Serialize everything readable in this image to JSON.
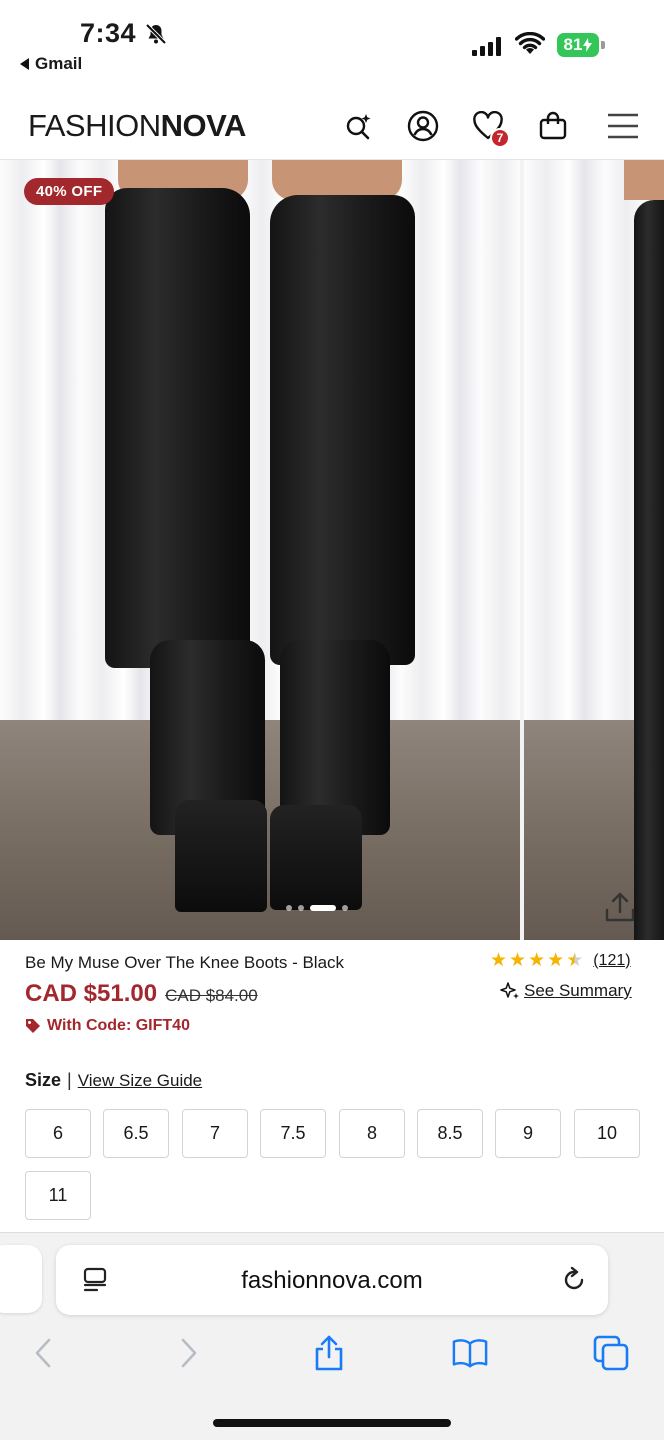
{
  "status_bar": {
    "time": "7:34",
    "back_app": "Gmail",
    "battery": "81",
    "icons": [
      "bell-slash-icon",
      "cellular-signal-icon",
      "wifi-icon",
      "battery-charging-icon"
    ]
  },
  "header": {
    "logo_light": "FASHION",
    "logo_bold": "NOVA",
    "wishlist_count": "7",
    "icons": [
      "ai-search-icon",
      "account-icon",
      "heart-icon",
      "bag-icon",
      "menu-icon"
    ]
  },
  "gallery": {
    "sale_badge": "40% OFF",
    "slide_count": 4,
    "active_slide": 3
  },
  "product": {
    "name": "Be My Muse Over The Knee Boots - Black",
    "rating": 4.5,
    "review_count": "(121)",
    "price_now": "CAD $51.00",
    "price_was": "CAD $84.00",
    "see_summary": "See Summary",
    "promo_code": "With Code: GIFT40"
  },
  "sizes": {
    "label": "Size",
    "separator": "|",
    "guide_link": "View Size Guide",
    "options": [
      "6",
      "6.5",
      "7",
      "7.5",
      "8",
      "8.5",
      "9",
      "10",
      "11"
    ]
  },
  "safari": {
    "url": "fashionnova.com",
    "toolbar": [
      "back-icon",
      "forward-icon",
      "share-icon",
      "bookmarks-icon",
      "tabs-icon"
    ]
  },
  "colors": {
    "accent_red": "#a3282d",
    "badge_red": "#c1272d",
    "star_gold": "#f4b400",
    "safari_blue": "#1a7cf5"
  }
}
